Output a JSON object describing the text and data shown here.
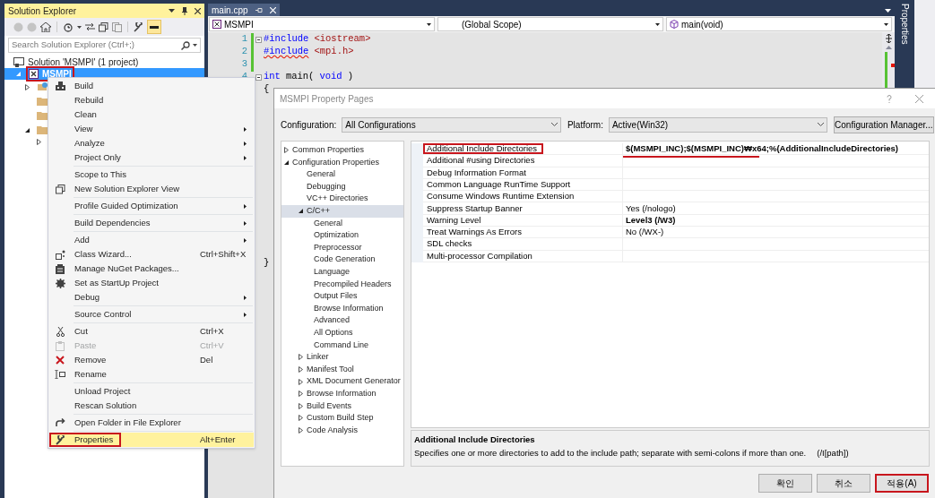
{
  "solution_explorer": {
    "title": "Solution Explorer",
    "search": {
      "placeholder": "Search Solution Explorer (Ctrl+;)"
    },
    "tree": [
      {
        "label": "Solution 'MSMPI' (1 project)",
        "selected": false,
        "highlighted": false
      },
      {
        "label": "MSMPI",
        "selected": true,
        "highlighted": true,
        "expanded": true
      }
    ]
  },
  "editor": {
    "tab": {
      "label": "main.cpp"
    },
    "nav": [
      "MSMPI",
      "(Global Scope)",
      "main(void)"
    ],
    "lines": [
      {
        "number": "1",
        "squiggle": false,
        "tokens": [
          {
            "kind": "directive",
            "text": "#include"
          },
          {
            "kind": "string",
            "text": "<iostream>"
          }
        ]
      },
      {
        "number": "2",
        "squiggle": true,
        "tokens": [
          {
            "kind": "directive",
            "text": "#include"
          },
          {
            "kind": "string",
            "text": "<mpi.h>"
          }
        ]
      },
      {
        "number": "3"
      },
      {
        "number": "4",
        "squiggle": false,
        "tokens": [
          {
            "kind": "keyword",
            "text": "int"
          },
          {
            "kind": "plain",
            "text": "main("
          },
          {
            "kind": "keyword",
            "text": "void"
          },
          {
            "kind": "plain",
            "text": ")"
          }
        ]
      },
      {
        "squiggle": false,
        "tokens": [
          {
            "kind": "plain",
            "text": "{"
          }
        ]
      }
    ],
    "closing": {
      "tokens": [
        {
          "kind": "plain",
          "text": "}"
        }
      ]
    }
  },
  "properties_tab": {
    "label": "Properties"
  },
  "context_menu": {
    "items": [
      {
        "kind": "item",
        "label": "Build",
        "submenu": false,
        "disabled": false,
        "selected": false,
        "highlighted": false
      },
      {
        "kind": "item",
        "label": "Rebuild",
        "submenu": false,
        "disabled": false,
        "selected": false,
        "highlighted": false
      },
      {
        "kind": "item",
        "label": "Clean",
        "submenu": false,
        "disabled": false,
        "selected": false,
        "highlighted": false
      },
      {
        "kind": "item",
        "label": "View",
        "submenu": true,
        "disabled": false,
        "selected": false,
        "highlighted": false
      },
      {
        "kind": "item",
        "label": "Analyze",
        "submenu": true,
        "disabled": false,
        "selected": false,
        "highlighted": false
      },
      {
        "kind": "item",
        "label": "Project Only",
        "submenu": true,
        "disabled": false,
        "selected": false,
        "highlighted": false
      },
      {
        "kind": "separator"
      },
      {
        "kind": "item",
        "label": "Scope to This",
        "submenu": false,
        "disabled": false,
        "selected": false,
        "highlighted": false
      },
      {
        "kind": "item",
        "label": "New Solution Explorer View",
        "submenu": false,
        "disabled": false,
        "selected": false,
        "highlighted": false
      },
      {
        "kind": "separator"
      },
      {
        "kind": "item",
        "label": "Profile Guided Optimization",
        "submenu": true,
        "disabled": false,
        "selected": false,
        "highlighted": false
      },
      {
        "kind": "separator"
      },
      {
        "kind": "item",
        "label": "Build Dependencies",
        "submenu": true,
        "disabled": false,
        "selected": false,
        "highlighted": false
      },
      {
        "kind": "separator"
      },
      {
        "kind": "item",
        "label": "Add",
        "submenu": true,
        "disabled": false,
        "selected": false,
        "highlighted": false
      },
      {
        "kind": "item",
        "label": "Class Wizard...",
        "shortcut": "Ctrl+Shift+X",
        "submenu": false,
        "disabled": false,
        "selected": false,
        "highlighted": false
      },
      {
        "kind": "item",
        "label": "Manage NuGet Packages...",
        "submenu": false,
        "disabled": false,
        "selected": false,
        "highlighted": false
      },
      {
        "kind": "item",
        "label": "Set as StartUp Project",
        "submenu": false,
        "disabled": false,
        "selected": false,
        "highlighted": false
      },
      {
        "kind": "item",
        "label": "Debug",
        "submenu": true,
        "disabled": false,
        "selected": false,
        "highlighted": false
      },
      {
        "kind": "separator"
      },
      {
        "kind": "item",
        "label": "Source Control",
        "submenu": true,
        "disabled": false,
        "selected": false,
        "highlighted": false
      },
      {
        "kind": "separator"
      },
      {
        "kind": "item",
        "label": "Cut",
        "shortcut": "Ctrl+X",
        "submenu": false,
        "disabled": false,
        "selected": false,
        "highlighted": false
      },
      {
        "kind": "item",
        "label": "Paste",
        "shortcut": "Ctrl+V",
        "submenu": false,
        "disabled": true,
        "selected": false,
        "highlighted": false
      },
      {
        "kind": "item",
        "label": "Remove",
        "shortcut": "Del",
        "submenu": false,
        "disabled": false,
        "selected": false,
        "highlighted": false
      },
      {
        "kind": "item",
        "label": "Rename",
        "submenu": false,
        "disabled": false,
        "selected": false,
        "highlighted": false
      },
      {
        "kind": "separator"
      },
      {
        "kind": "item",
        "label": "Unload Project",
        "submenu": false,
        "disabled": false,
        "selected": false,
        "highlighted": false
      },
      {
        "kind": "item",
        "label": "Rescan Solution",
        "submenu": false,
        "disabled": false,
        "selected": false,
        "highlighted": false
      },
      {
        "kind": "separator"
      },
      {
        "kind": "item",
        "label": "Open Folder in File Explorer",
        "submenu": false,
        "disabled": false,
        "selected": false,
        "highlighted": false
      },
      {
        "kind": "separator"
      },
      {
        "kind": "item",
        "label": "Properties",
        "shortcut": "Alt+Enter",
        "submenu": false,
        "disabled": false,
        "selected": true,
        "highlighted": true
      }
    ]
  },
  "dialog": {
    "title": "MSMPI Property Pages",
    "configuration": {
      "label": "Configuration:",
      "value": "All Configurations"
    },
    "platform": {
      "label": "Platform:",
      "value": "Active(Win32)"
    },
    "manager_button": "Configuration Manager...",
    "tree": [
      {
        "label": "Common Properties",
        "expanded": false,
        "selected": false
      },
      {
        "label": "Configuration Properties",
        "expanded": true,
        "selected": false,
        "children": [
          {
            "label": "General",
            "selected": false
          },
          {
            "label": "Debugging",
            "selected": false
          },
          {
            "label": "VC++ Directories",
            "selected": false
          },
          {
            "label": "C/C++",
            "expanded": true,
            "selected": true,
            "children": [
              {
                "label": "General",
                "selected": false
              },
              {
                "label": "Optimization",
                "selected": false
              },
              {
                "label": "Preprocessor",
                "selected": false
              },
              {
                "label": "Code Generation",
                "selected": false
              },
              {
                "label": "Language",
                "selected": false
              },
              {
                "label": "Precompiled Headers",
                "selected": false
              },
              {
                "label": "Output Files",
                "selected": false
              },
              {
                "label": "Browse Information",
                "selected": false
              },
              {
                "label": "Advanced",
                "selected": false
              },
              {
                "label": "All Options",
                "selected": false
              },
              {
                "label": "Command Line",
                "selected": false
              }
            ]
          },
          {
            "label": "Linker",
            "expanded": false,
            "selected": false
          },
          {
            "label": "Manifest Tool",
            "expanded": false,
            "selected": false
          },
          {
            "label": "XML Document Generator",
            "expanded": false,
            "selected": false
          },
          {
            "label": "Browse Information",
            "expanded": false,
            "selected": false
          },
          {
            "label": "Build Events",
            "expanded": false,
            "selected": false
          },
          {
            "label": "Custom Build Step",
            "expanded": false,
            "selected": false
          },
          {
            "label": "Code Analysis",
            "expanded": false,
            "selected": false
          }
        ]
      }
    ],
    "properties": [
      {
        "name": "Additional Include Directories",
        "value": "$(MSMPI_INC);$(MSMPI_INC)₩x64;%(AdditionalIncludeDirectories)",
        "modified": true,
        "highlighted": true
      },
      {
        "name": "Additional #using Directories",
        "highlighted": false
      },
      {
        "name": "Debug Information Format",
        "highlighted": false
      },
      {
        "name": "Common Language RunTime Support",
        "highlighted": false
      },
      {
        "name": "Consume Windows Runtime Extension",
        "highlighted": false
      },
      {
        "name": "Suppress Startup Banner",
        "value": "Yes (/nologo)",
        "modified": false,
        "highlighted": false
      },
      {
        "name": "Warning Level",
        "value": "Level3 (/W3)",
        "modified": true,
        "highlighted": false
      },
      {
        "name": "Treat Warnings As Errors",
        "value": "No (/WX-)",
        "modified": false,
        "highlighted": false
      },
      {
        "name": "SDL checks",
        "highlighted": false
      },
      {
        "name": "Multi-processor Compilation",
        "highlighted": false
      }
    ],
    "description": {
      "title": "Additional Include Directories",
      "text": "Specifies one or more directories to add to the include path; separate with semi-colons if more than one.",
      "switch": "(/I[path])"
    },
    "buttons": [
      {
        "label": "확인",
        "highlighted": false
      },
      {
        "label": "취소",
        "highlighted": false
      },
      {
        "label": "적용(A)",
        "highlighted": true
      }
    ]
  }
}
